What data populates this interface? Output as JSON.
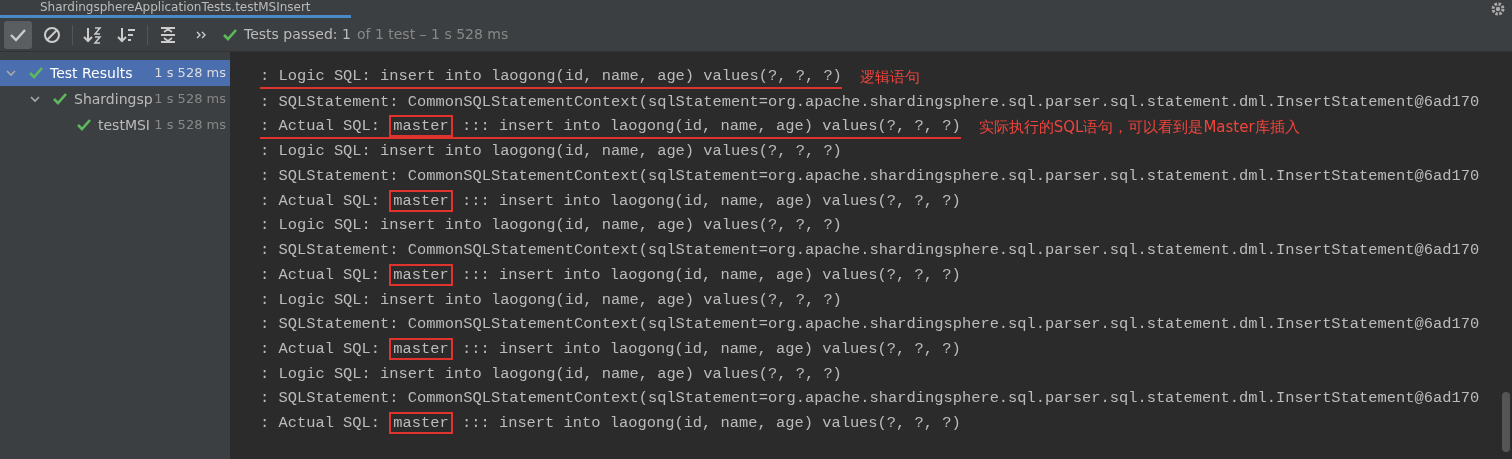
{
  "tab": {
    "title": "ShardingsphereApplicationTests.testMSInsert",
    "selected": true
  },
  "toolbar": {
    "status_main": "Tests passed: 1",
    "status_detail": "of 1 test – 1 s 528 ms",
    "show_passed": true,
    "show_ignored": false
  },
  "tree": [
    {
      "label": "Test Results",
      "time": "1 s 528 ms",
      "selected": true,
      "expanded": true,
      "children": [
        {
          "label": "Shardingsp",
          "time": "1 s 528 ms",
          "selected": false,
          "expanded": true,
          "children": [
            {
              "label": "testMSI",
              "time": "1 s 528 ms",
              "selected": false
            }
          ]
        }
      ]
    }
  ],
  "console": [
    {
      "kind": "logic",
      "text": ": Logic SQL: insert into laogong(id, name, age) values(?, ?, ?)",
      "underlined": true,
      "note": "逻辑语句"
    },
    {
      "kind": "statement",
      "text": ": SQLStatement: CommonSQLStatementContext(sqlStatement=org.apache.shardingsphere.sql.parser.sql.statement.dml.InsertStatement@6ad170"
    },
    {
      "kind": "actual",
      "prefix": ": Actual SQL: ",
      "target": "master",
      "rest": " ::: insert into laogong(id, name, age) values(?, ?, ?)",
      "boxed": true,
      "underlined": true,
      "note": "实际执行的SQL语句，可以看到是Master库插入"
    },
    {
      "kind": "logic",
      "text": ": Logic SQL: insert into laogong(id, name, age) values(?, ?, ?)",
      "underlined": false
    },
    {
      "kind": "statement",
      "text": ": SQLStatement: CommonSQLStatementContext(sqlStatement=org.apache.shardingsphere.sql.parser.sql.statement.dml.InsertStatement@6ad170"
    },
    {
      "kind": "actual",
      "prefix": ": Actual SQL: ",
      "target": "master",
      "rest": " ::: insert into laogong(id, name, age) values(?, ?, ?)",
      "boxed": true,
      "underlined": false
    },
    {
      "kind": "logic",
      "text": ": Logic SQL: insert into laogong(id, name, age) values(?, ?, ?)",
      "underlined": false
    },
    {
      "kind": "statement",
      "text": ": SQLStatement: CommonSQLStatementContext(sqlStatement=org.apache.shardingsphere.sql.parser.sql.statement.dml.InsertStatement@6ad170"
    },
    {
      "kind": "actual",
      "prefix": ": Actual SQL: ",
      "target": "master",
      "rest": " ::: insert into laogong(id, name, age) values(?, ?, ?)",
      "boxed": true,
      "underlined": false
    },
    {
      "kind": "logic",
      "text": ": Logic SQL: insert into laogong(id, name, age) values(?, ?, ?)",
      "underlined": false
    },
    {
      "kind": "statement",
      "text": ": SQLStatement: CommonSQLStatementContext(sqlStatement=org.apache.shardingsphere.sql.parser.sql.statement.dml.InsertStatement@6ad170"
    },
    {
      "kind": "actual",
      "prefix": ": Actual SQL: ",
      "target": "master",
      "rest": " ::: insert into laogong(id, name, age) values(?, ?, ?)",
      "boxed": true,
      "underlined": false
    },
    {
      "kind": "logic",
      "text": ": Logic SQL: insert into laogong(id, name, age) values(?, ?, ?)",
      "underlined": false
    },
    {
      "kind": "statement",
      "text": ": SQLStatement: CommonSQLStatementContext(sqlStatement=org.apache.shardingsphere.sql.parser.sql.statement.dml.InsertStatement@6ad170"
    },
    {
      "kind": "actual",
      "prefix": ": Actual SQL: ",
      "target": "master",
      "rest": " ::: insert into laogong(id, name, age) values(?, ?, ?)",
      "boxed": true,
      "underlined": false
    }
  ]
}
